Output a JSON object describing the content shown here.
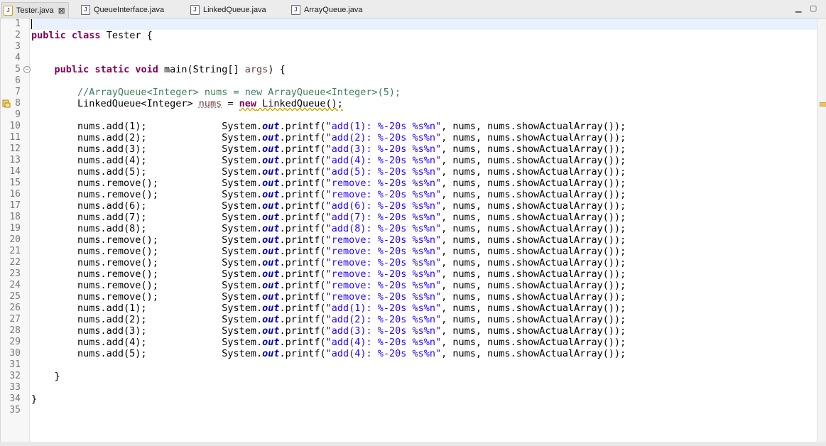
{
  "tabs": [
    {
      "label": "Tester.java",
      "active": true,
      "close_icon": "close-icon"
    },
    {
      "label": "QueueInterface.java",
      "active": false
    },
    {
      "label": "LinkedQueue.java",
      "active": false
    },
    {
      "label": "ArrayQueue.java",
      "active": false
    }
  ],
  "line_numbers": [
    "1",
    "2",
    "3",
    "4",
    "5",
    "6",
    "7",
    "8",
    "9",
    "10",
    "11",
    "12",
    "13",
    "14",
    "15",
    "16",
    "17",
    "18",
    "19",
    "20",
    "21",
    "22",
    "23",
    "24",
    "25",
    "26",
    "27",
    "28",
    "29",
    "30",
    "31",
    "32",
    "33",
    "34",
    "35"
  ],
  "code": {
    "class_decl": {
      "kw1": "public",
      "kw2": "class",
      "name": " Tester {"
    },
    "main_decl": {
      "kw1": "public",
      "kw2": "static",
      "kw3": "void",
      "rest": " main(String[] ",
      "param": "args",
      "end": ") {"
    },
    "comment": "//ArrayQueue<Integer> nums = new ArrayQueue<Integer>(5);",
    "decl": {
      "type": "LinkedQueue<Integer> ",
      "var": "nums",
      "eq": " = ",
      "kw": "new",
      "ctor": " LinkedQueue();"
    },
    "statements": [
      {
        "call": "nums.add(1);",
        "fmt": "\"add(1): %-20s %s%n\""
      },
      {
        "call": "nums.add(2);",
        "fmt": "\"add(2): %-20s %s%n\""
      },
      {
        "call": "nums.add(3);",
        "fmt": "\"add(3): %-20s %s%n\""
      },
      {
        "call": "nums.add(4);",
        "fmt": "\"add(4): %-20s %s%n\""
      },
      {
        "call": "nums.add(5);",
        "fmt": "\"add(5): %-20s %s%n\""
      },
      {
        "call": "nums.remove();",
        "fmt": "\"remove: %-20s %s%n\""
      },
      {
        "call": "nums.remove();",
        "fmt": "\"remove: %-20s %s%n\""
      },
      {
        "call": "nums.add(6);",
        "fmt": "\"add(6): %-20s %s%n\""
      },
      {
        "call": "nums.add(7);",
        "fmt": "\"add(7): %-20s %s%n\""
      },
      {
        "call": "nums.add(8);",
        "fmt": "\"add(8): %-20s %s%n\""
      },
      {
        "call": "nums.remove();",
        "fmt": "\"remove: %-20s %s%n\""
      },
      {
        "call": "nums.remove();",
        "fmt": "\"remove: %-20s %s%n\""
      },
      {
        "call": "nums.remove();",
        "fmt": "\"remove: %-20s %s%n\""
      },
      {
        "call": "nums.remove();",
        "fmt": "\"remove: %-20s %s%n\""
      },
      {
        "call": "nums.remove();",
        "fmt": "\"remove: %-20s %s%n\""
      },
      {
        "call": "nums.remove();",
        "fmt": "\"remove: %-20s %s%n\""
      },
      {
        "call": "nums.add(1);",
        "fmt": "\"add(1): %-20s %s%n\""
      },
      {
        "call": "nums.add(2);",
        "fmt": "\"add(2): %-20s %s%n\""
      },
      {
        "call": "nums.add(3);",
        "fmt": "\"add(3): %-20s %s%n\""
      },
      {
        "call": "nums.add(4);",
        "fmt": "\"add(4): %-20s %s%n\""
      },
      {
        "call": "nums.add(5);",
        "fmt": "\"add(4): %-20s %s%n\""
      }
    ],
    "printf_prefix": "System.",
    "printf_field": "out",
    "printf_method": ".printf(",
    "printf_args": ", nums, nums.showActualArray());",
    "close_method": "}",
    "close_class": "}"
  },
  "colors": {
    "keyword": "#7f0055",
    "string": "#2a00ff",
    "comment": "#3f7f5f",
    "field": "#0000c0",
    "current_line": "#e8f2fe"
  }
}
